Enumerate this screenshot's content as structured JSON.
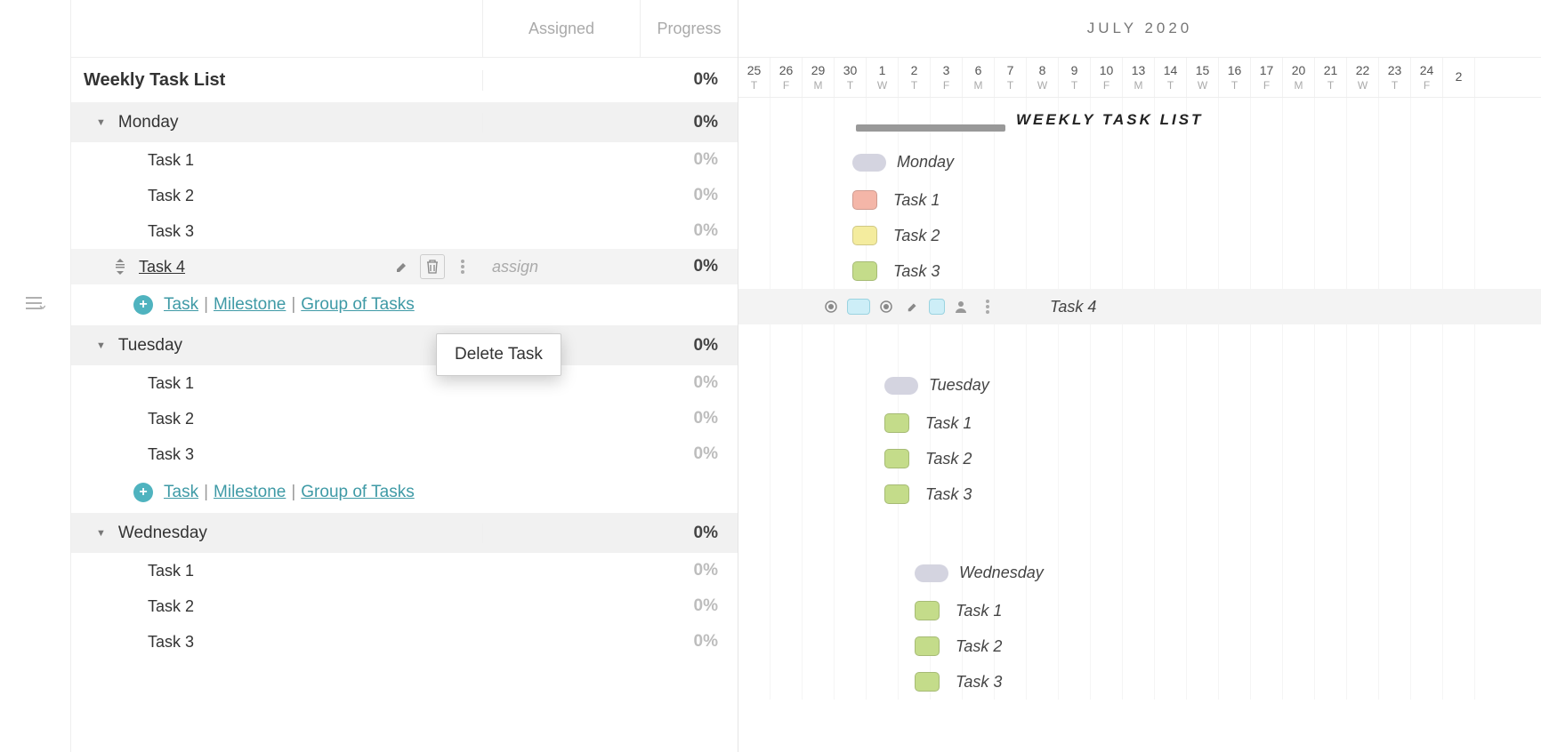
{
  "columns": {
    "assigned": "Assigned",
    "progress": "Progress"
  },
  "title": "Weekly Task List",
  "title_progress": "0%",
  "context_menu": {
    "label": "Delete Task"
  },
  "assign_placeholder": "assign",
  "add_links": {
    "task": "Task",
    "milestone": "Milestone",
    "group": "Group of Tasks"
  },
  "groups": [
    {
      "name": "Monday",
      "progress": "0%",
      "tasks": [
        {
          "name": "Task 1",
          "progress": "0%",
          "color": "#f4b6a8"
        },
        {
          "name": "Task 2",
          "progress": "0%",
          "color": "#f4ec9e"
        },
        {
          "name": "Task 3",
          "progress": "0%",
          "color": "#c4dc8a"
        },
        {
          "name": "Task 4",
          "progress": "0%",
          "color": "#cdeef7",
          "selected": true
        }
      ],
      "show_add": true
    },
    {
      "name": "Tuesday",
      "progress": "0%",
      "tasks": [
        {
          "name": "Task 1",
          "progress": "0%",
          "color": "#c4dc8a"
        },
        {
          "name": "Task 2",
          "progress": "0%",
          "color": "#c4dc8a"
        },
        {
          "name": "Task 3",
          "progress": "0%",
          "color": "#c4dc8a"
        }
      ],
      "show_add": true
    },
    {
      "name": "Wednesday",
      "progress": "0%",
      "tasks": [
        {
          "name": "Task 1",
          "progress": "0%",
          "color": "#c4dc8a"
        },
        {
          "name": "Task 2",
          "progress": "0%",
          "color": "#c4dc8a"
        },
        {
          "name": "Task 3",
          "progress": "0%",
          "color": "#c4dc8a"
        }
      ],
      "show_add": false
    }
  ],
  "timeline": {
    "month": "JULY 2020",
    "title_label": "WEEKLY TASK LIST",
    "dates": [
      {
        "d": "25",
        "w": "T"
      },
      {
        "d": "26",
        "w": "F"
      },
      {
        "d": "29",
        "w": "M"
      },
      {
        "d": "30",
        "w": "T"
      },
      {
        "d": "1",
        "w": "W"
      },
      {
        "d": "2",
        "w": "T"
      },
      {
        "d": "3",
        "w": "F"
      },
      {
        "d": "6",
        "w": "M"
      },
      {
        "d": "7",
        "w": "T"
      },
      {
        "d": "8",
        "w": "W"
      },
      {
        "d": "9",
        "w": "T"
      },
      {
        "d": "10",
        "w": "F"
      },
      {
        "d": "13",
        "w": "M"
      },
      {
        "d": "14",
        "w": "T"
      },
      {
        "d": "15",
        "w": "W"
      },
      {
        "d": "16",
        "w": "T"
      },
      {
        "d": "17",
        "w": "F"
      },
      {
        "d": "20",
        "w": "M"
      },
      {
        "d": "21",
        "w": "T"
      },
      {
        "d": "22",
        "w": "W"
      },
      {
        "d": "23",
        "w": "T"
      },
      {
        "d": "24",
        "w": "F"
      },
      {
        "d": "2",
        "w": ""
      }
    ],
    "group_bar_offsets": [
      128,
      164,
      198
    ],
    "task_bar_offsets": [
      128,
      164,
      198
    ],
    "selected_task_label": "Task 4"
  }
}
